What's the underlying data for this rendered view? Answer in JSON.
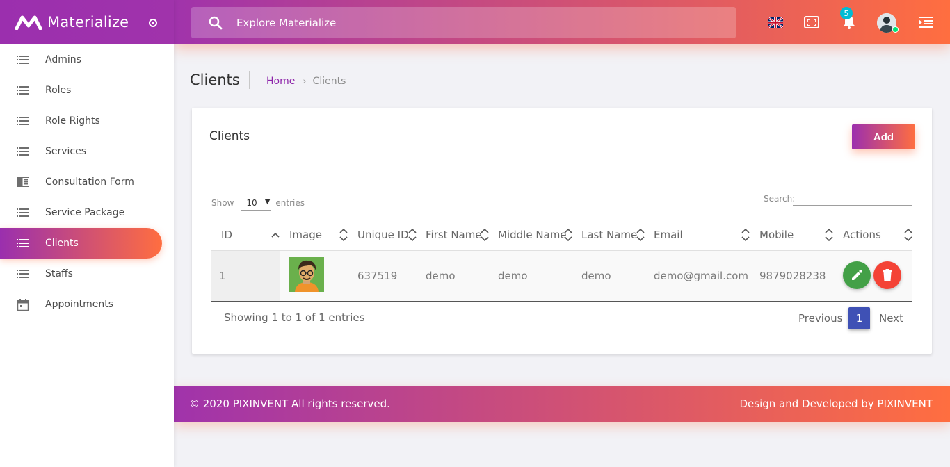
{
  "brand": {
    "name": "Materialize"
  },
  "search": {
    "placeholder": "Explore Materialize"
  },
  "topbar": {
    "notification_count": "5"
  },
  "sidebar": {
    "items": [
      {
        "label": "Admins",
        "icon": "list-icon"
      },
      {
        "label": "Roles",
        "icon": "list-icon"
      },
      {
        "label": "Role Rights",
        "icon": "list-icon"
      },
      {
        "label": "Services",
        "icon": "list-icon"
      },
      {
        "label": "Consultation Form",
        "icon": "chrome-reader-mode-icon"
      },
      {
        "label": "Service Package",
        "icon": "list-icon"
      },
      {
        "label": "Clients",
        "icon": "list-icon",
        "active": true
      },
      {
        "label": "Staffs",
        "icon": "list-icon"
      },
      {
        "label": "Appointments",
        "icon": "calendar-icon"
      }
    ]
  },
  "page": {
    "title": "Clients",
    "breadcrumb": {
      "home": "Home",
      "separator": "›",
      "current": "Clients"
    }
  },
  "card": {
    "title": "Clients",
    "add_label": "Add",
    "show_label": "Show",
    "show_value": "10",
    "entries_label": "entries",
    "search_label": "Search:"
  },
  "table": {
    "columns": [
      "ID",
      "Image",
      "Unique ID",
      "First Name",
      "Middle Name",
      "Last Name",
      "Email",
      "Mobile",
      "Actions"
    ],
    "rows": [
      {
        "id": "1",
        "unique_id": "637519",
        "first_name": "demo",
        "middle_name": "demo",
        "last_name": "demo",
        "email": "demo@gmail.com",
        "mobile": "9879028238"
      }
    ]
  },
  "pagination": {
    "info": "Showing 1 to 1 of 1 entries",
    "previous": "Previous",
    "current": "1",
    "next": "Next"
  },
  "footer": {
    "copyright_prefix": "© 2020",
    "company": "PIXINVENT",
    "rights": "All rights reserved.",
    "credit_prefix": "Design and Developed by",
    "credit_company": "PIXINVENT"
  },
  "colors": {
    "gradient_start": "#9c2fae",
    "gradient_end": "#ff6e40",
    "edit": "#43a047",
    "delete": "#f44336",
    "page_active": "#3f51b5",
    "badge": "#00bcd4"
  }
}
